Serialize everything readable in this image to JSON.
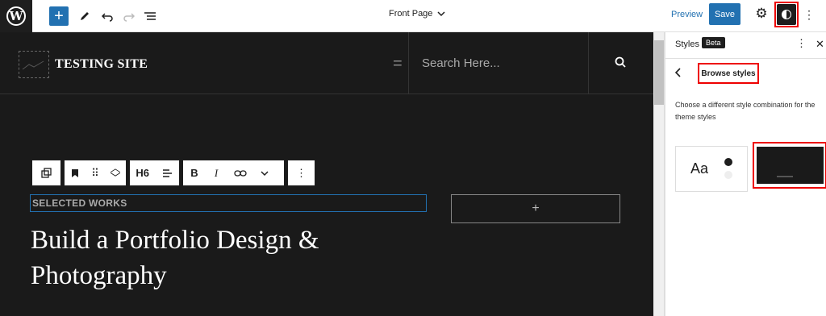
{
  "topbar": {
    "document_title": "Front Page",
    "preview_label": "Preview",
    "save_label": "Save"
  },
  "canvas": {
    "site_title": "TESTING SITE",
    "search_placeholder": "Search Here...",
    "toolbar": {
      "heading_level": "H6"
    },
    "selected_works": "SELECTED WORKS",
    "heading": "Build a Portfolio Design & Photography",
    "add_block_symbol": "+"
  },
  "sidebar": {
    "title": "Styles",
    "badge": "Beta",
    "browse_label": "Browse styles",
    "description": "Choose a different style combination for the theme styles",
    "variation_sample": "Aa"
  },
  "colors": {
    "accent": "#2271b1",
    "highlight": "#ee0000",
    "canvas_bg": "#1a1a1a"
  }
}
